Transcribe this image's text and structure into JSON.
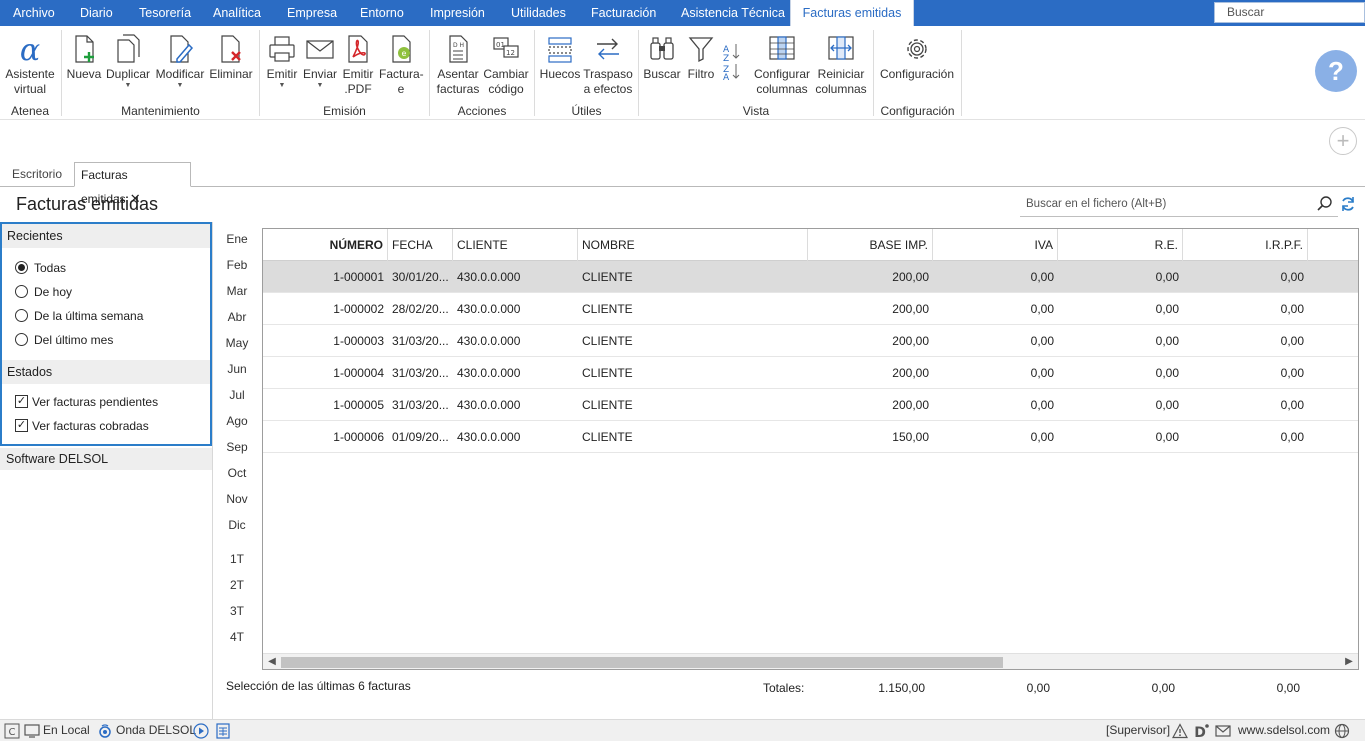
{
  "menu": {
    "tabs": [
      "Archivo",
      "Diario",
      "Tesorería",
      "Analítica",
      "Empresa",
      "Entorno",
      "Impresión",
      "Utilidades",
      "Facturación",
      "Asistencia Técnica",
      "Facturas emitidas"
    ],
    "search_placeholder": "Buscar"
  },
  "ribbon": {
    "buttons": {
      "asistente": [
        "Asistente",
        "virtual"
      ],
      "nueva": "Nueva",
      "duplicar": "Duplicar",
      "modificar": "Modificar",
      "eliminar": "Eliminar",
      "emitir": "Emitir",
      "enviar": "Enviar",
      "emitir_pdf": [
        "Emitir",
        ".PDF"
      ],
      "facturae": [
        "Factura-",
        "e"
      ],
      "asentar": [
        "Asentar",
        "facturas"
      ],
      "cambiar": [
        "Cambiar",
        "código"
      ],
      "huecos": "Huecos",
      "traspaso": [
        "Traspaso",
        "a efectos"
      ],
      "buscar": "Buscar",
      "filtro": "Filtro",
      "configurar": [
        "Configurar",
        "columnas"
      ],
      "reiniciar": [
        "Reiniciar",
        "columnas"
      ],
      "configuracion": "Configuración"
    },
    "groups": {
      "atenea": "Atenea",
      "mantenimiento": "Mantenimiento",
      "emision": "Emisión",
      "acciones": "Acciones",
      "utiles": "Útiles",
      "vista": "Vista",
      "configuracion": "Configuración"
    }
  },
  "doc_tabs": {
    "escritorio": "Escritorio",
    "facturas": "Facturas emitidas"
  },
  "page": {
    "title": "Facturas emitidas",
    "search_placeholder": "Buscar en el fichero (Alt+B)"
  },
  "left_panel": {
    "recientes_title": "Recientes",
    "radios": [
      "Todas",
      "De hoy",
      "De la última semana",
      "Del último mes"
    ],
    "radio_selected": 0,
    "estados_title": "Estados",
    "checks": [
      "Ver facturas pendientes",
      "Ver facturas cobradas"
    ],
    "footer": "Software DELSOL"
  },
  "months": [
    "Ene",
    "Feb",
    "Mar",
    "Abr",
    "May",
    "Jun",
    "Jul",
    "Ago",
    "Sep",
    "Oct",
    "Nov",
    "Dic"
  ],
  "quarters": [
    "1T",
    "2T",
    "3T",
    "4T"
  ],
  "table": {
    "columns": [
      "NÚMERO",
      "FECHA",
      "CLIENTE",
      "NOMBRE",
      "BASE IMP.",
      "IVA",
      "R.E.",
      "I.R.P.F."
    ],
    "rows": [
      [
        "1-000001",
        "30/01/20...",
        "430.0.0.000",
        "CLIENTE",
        "200,00",
        "0,00",
        "0,00",
        "0,00"
      ],
      [
        "1-000002",
        "28/02/20...",
        "430.0.0.000",
        "CLIENTE",
        "200,00",
        "0,00",
        "0,00",
        "0,00"
      ],
      [
        "1-000003",
        "31/03/20...",
        "430.0.0.000",
        "CLIENTE",
        "200,00",
        "0,00",
        "0,00",
        "0,00"
      ],
      [
        "1-000004",
        "31/03/20...",
        "430.0.0.000",
        "CLIENTE",
        "200,00",
        "0,00",
        "0,00",
        "0,00"
      ],
      [
        "1-000005",
        "31/03/20...",
        "430.0.0.000",
        "CLIENTE",
        "200,00",
        "0,00",
        "0,00",
        "0,00"
      ],
      [
        "1-000006",
        "01/09/20...",
        "430.0.0.000",
        "CLIENTE",
        "150,00",
        "0,00",
        "0,00",
        "0,00"
      ]
    ]
  },
  "footer": {
    "selection": "Selección de las últimas 6 facturas",
    "totals_label": "Totales:",
    "totals": [
      "1.150,00",
      "0,00",
      "0,00",
      "0,00"
    ]
  },
  "status": {
    "local": "En Local",
    "onda": "Onda DELSOL",
    "supervisor": "[Supervisor]",
    "web": "www.sdelsol.com"
  },
  "colors": {
    "accent": "#2b6cc4",
    "panel_border": "#2b7dc9",
    "selected_row": "#dcdcdc"
  }
}
